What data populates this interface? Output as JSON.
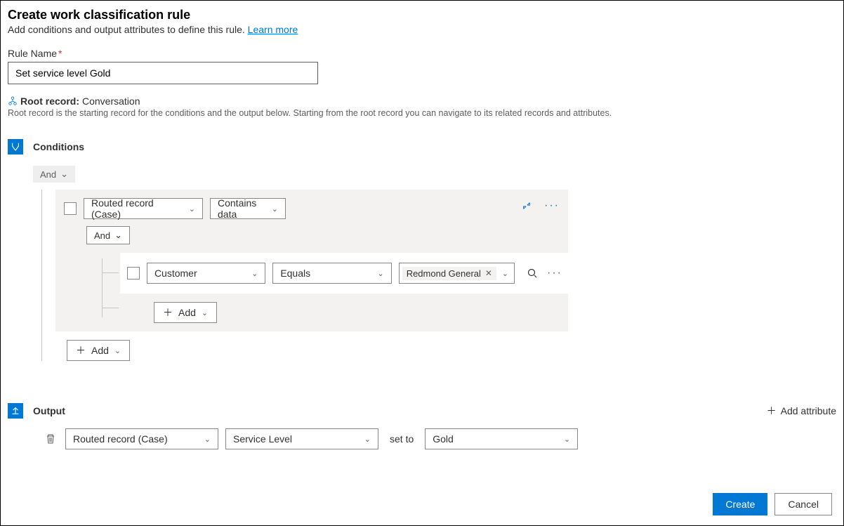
{
  "header": {
    "title": "Create work classification rule",
    "subtitle_prefix": "Add conditions and output attributes to define this rule. ",
    "learn_more": "Learn more"
  },
  "rule_name": {
    "label": "Rule Name",
    "value": "Set service level Gold"
  },
  "root_record": {
    "label": "Root record:",
    "value": "Conversation",
    "description": "Root record is the starting record for the conditions and the output below. Starting from the root record you can navigate to its related records and attributes."
  },
  "conditions": {
    "title": "Conditions",
    "top_join": "And",
    "group": {
      "field": "Routed record (Case)",
      "operator": "Contains data",
      "inner_join": "And",
      "child": {
        "field": "Customer",
        "operator": "Equals",
        "value_chip": "Redmond General"
      },
      "inner_add": "Add"
    },
    "outer_add": "Add"
  },
  "output": {
    "title": "Output",
    "add_attribute": "Add attribute",
    "row": {
      "entity": "Routed record (Case)",
      "attribute": "Service Level",
      "set_to_label": "set to",
      "value": "Gold"
    }
  },
  "footer": {
    "create": "Create",
    "cancel": "Cancel"
  }
}
